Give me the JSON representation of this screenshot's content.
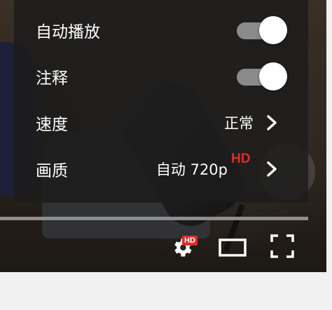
{
  "settings_menu": {
    "autoplay": {
      "label": "自动播放",
      "enabled": true
    },
    "annotations": {
      "label": "注释",
      "enabled": true
    },
    "speed": {
      "label": "速度",
      "value": "正常"
    },
    "quality": {
      "label": "画质",
      "value": "自动 720p",
      "badge": "HD"
    }
  },
  "controls": {
    "settings_badge": "HD",
    "icons": [
      "gear-icon",
      "theater-mode-icon",
      "fullscreen-icon",
      "chevron-right-icon"
    ]
  },
  "colors": {
    "accent_red": "#e02b2b",
    "menu_bg": "#1c1c1c",
    "toggle_track": "#8a8a8a"
  }
}
